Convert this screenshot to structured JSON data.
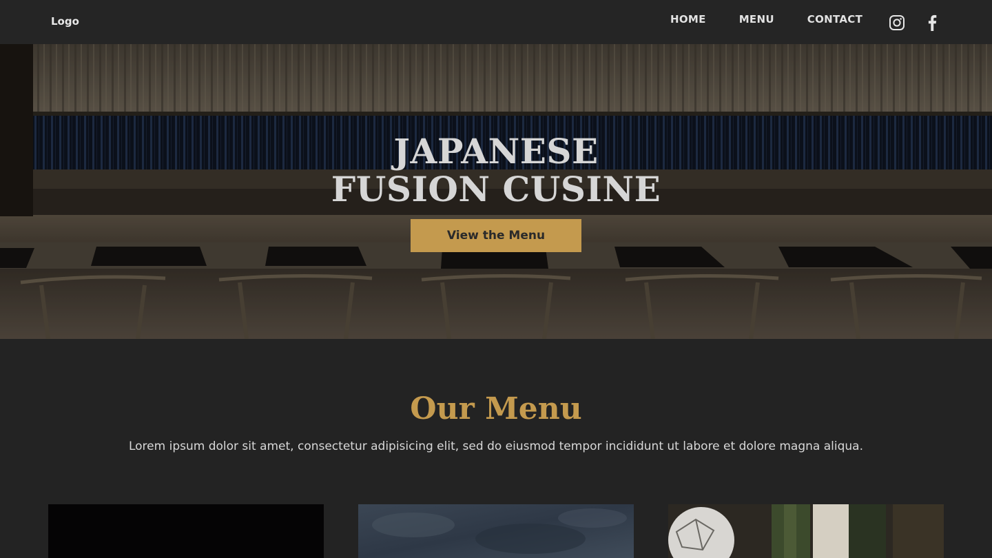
{
  "nav": {
    "logo": "Logo",
    "links": [
      "HOME",
      "MENU",
      "CONTACT"
    ],
    "social_icons": [
      "instagram-icon",
      "facebook-icon"
    ]
  },
  "hero": {
    "title_line1": "JAPANESE",
    "title_line2": "FUSION CUSINE",
    "button_label": "View the Menu"
  },
  "menu": {
    "title": "Our Menu",
    "description": "Lorem ipsum dolor sit amet, consectetur adipisicing elit, sed do eiusmod tempor incididunt ut labore et dolore magna aliqua."
  },
  "colors": {
    "accent": "#c49a4e",
    "background": "#232323",
    "nav_background": "#252525"
  }
}
